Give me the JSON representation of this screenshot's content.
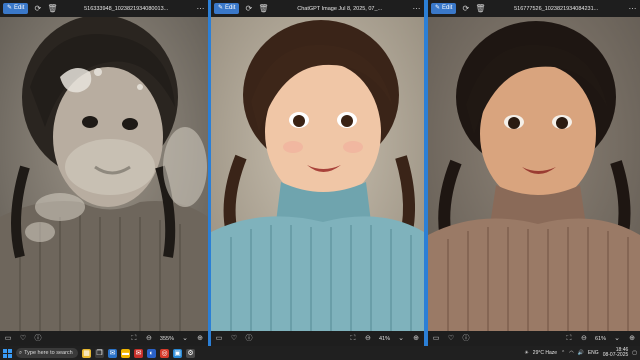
{
  "windows": [
    {
      "edit_label": "Edit",
      "title": "516333948_1023821934080013...",
      "zoom": "355%",
      "photo_desc": "grayscale-damaged"
    },
    {
      "edit_label": "Edit",
      "title": "ChatGPT Image Jul 8, 2025, 07_...",
      "zoom": "41%",
      "photo_desc": "color-teal-sweater"
    },
    {
      "edit_label": "Edit",
      "title": "516777526_1023821934084231...",
      "zoom": "61%",
      "photo_desc": "color-brown-sweater"
    }
  ],
  "taskbar": {
    "search_placeholder": "Type here to search",
    "weather": "29°C  Haze",
    "language": "ENG",
    "time": "18:46",
    "date": "08-07-2025"
  },
  "colors": {
    "accent": "#3a78c9",
    "taskbar_bg": "#202020",
    "window_chrome": "#1e1e1e"
  }
}
